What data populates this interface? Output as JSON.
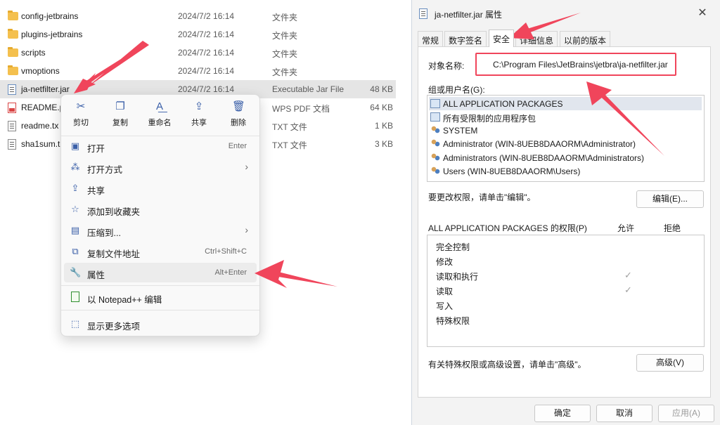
{
  "explorer": {
    "files": [
      {
        "name": "config-jetbrains",
        "date": "2024/7/2 16:14",
        "type": "文件夹",
        "size": "",
        "icon": "folder-icon"
      },
      {
        "name": "plugins-jetbrains",
        "date": "2024/7/2 16:14",
        "type": "文件夹",
        "size": "",
        "icon": "folder-icon"
      },
      {
        "name": "scripts",
        "date": "2024/7/2 16:14",
        "type": "文件夹",
        "size": "",
        "icon": "folder-icon"
      },
      {
        "name": "vmoptions",
        "date": "2024/7/2 16:14",
        "type": "文件夹",
        "size": "",
        "icon": "folder-icon"
      },
      {
        "name": "ja-netfilter.jar",
        "date": "2024/7/2 16:14",
        "type": "Executable Jar File",
        "size": "48 KB",
        "icon": "jar-file-icon"
      },
      {
        "name": "README.p",
        "date": "",
        "type": "WPS PDF 文档",
        "size": "64 KB",
        "icon": "pdf-file-icon"
      },
      {
        "name": "readme.tx",
        "date": "",
        "type": "TXT 文件",
        "size": "1 KB",
        "icon": "text-file-icon"
      },
      {
        "name": "sha1sum.t",
        "date": "",
        "type": "TXT 文件",
        "size": "3 KB",
        "icon": "text-file-icon"
      }
    ]
  },
  "context_menu": {
    "toolbar": [
      {
        "label": "剪切",
        "icon": "cut-icon"
      },
      {
        "label": "复制",
        "icon": "copy-icon"
      },
      {
        "label": "重命名",
        "icon": "rename-icon"
      },
      {
        "label": "共享",
        "icon": "share-icon"
      },
      {
        "label": "删除",
        "icon": "delete-icon"
      }
    ],
    "items": [
      {
        "label": "打开",
        "shortcut": "Enter",
        "icon": "open-icon"
      },
      {
        "label": "打开方式",
        "shortcut": "",
        "icon": "open-with-icon",
        "arrow": "›"
      },
      {
        "label": "共享",
        "shortcut": "",
        "icon": "share-icon"
      },
      {
        "label": "添加到收藏夹",
        "shortcut": "",
        "icon": "star-icon"
      },
      {
        "label": "压缩到...",
        "shortcut": "",
        "icon": "compress-icon",
        "arrow": "›"
      },
      {
        "label": "复制文件地址",
        "shortcut": "Ctrl+Shift+C",
        "icon": "copy-path-icon"
      },
      {
        "label": "属性",
        "shortcut": "Alt+Enter",
        "icon": "wrench-icon"
      },
      {
        "label": "以 Notepad++ 编辑",
        "shortcut": "",
        "icon": "notepad-icon"
      },
      {
        "label": "显示更多选项",
        "shortcut": "",
        "icon": "more-options-icon"
      }
    ]
  },
  "dialog": {
    "title": "ja-netfilter.jar 属性",
    "close_glyph": "✕",
    "tabs": [
      {
        "label": "常规",
        "active": false
      },
      {
        "label": "数字签名",
        "active": false
      },
      {
        "label": "安全",
        "active": true
      },
      {
        "label": "详细信息",
        "active": false
      },
      {
        "label": "以前的版本",
        "active": false
      }
    ],
    "object_name_label": "对象名称:",
    "object_name_value": "C:\\Program Files\\JetBrains\\jetbra\\ja-netfilter.jar",
    "groups_label": "组或用户名(G):",
    "groups": [
      {
        "name": "ALL APPLICATION PACKAGES",
        "icon": "package-icon",
        "selected": true
      },
      {
        "name": "所有受限制的应用程序包",
        "icon": "package-icon",
        "selected": false
      },
      {
        "name": "SYSTEM",
        "icon": "users-icon",
        "selected": false
      },
      {
        "name": "Administrator (WIN-8UEB8DAAORM\\Administrator)",
        "icon": "users-icon",
        "selected": false
      },
      {
        "name": "Administrators (WIN-8UEB8DAAORM\\Administrators)",
        "icon": "users-icon",
        "selected": false
      },
      {
        "name": "Users (WIN-8UEB8DAAORM\\Users)",
        "icon": "users-icon",
        "selected": false
      }
    ],
    "change_perm_text": "要更改权限，请单击\"编辑\"。",
    "edit_button": "编辑(E)...",
    "perm_for_label": "ALL APPLICATION PACKAGES 的权限(P)",
    "allow_header": "允许",
    "deny_header": "拒绝",
    "permissions": [
      {
        "name": "完全控制",
        "allow": false
      },
      {
        "name": "修改",
        "allow": false
      },
      {
        "name": "读取和执行",
        "allow": true
      },
      {
        "name": "读取",
        "allow": true
      },
      {
        "name": "写入",
        "allow": false
      },
      {
        "name": "特殊权限",
        "allow": false
      }
    ],
    "check_glyph": "✓",
    "advanced_text": "有关特殊权限或高级设置，请单击\"高级\"。",
    "advanced_button": "高级(V)",
    "ok_button": "确定",
    "cancel_button": "取消",
    "apply_button": "应用(A)"
  },
  "colors": {
    "annotation_red": "#f0455b",
    "selected_row": "#e5e5e5",
    "accent_blue": "#3a5fa8"
  }
}
